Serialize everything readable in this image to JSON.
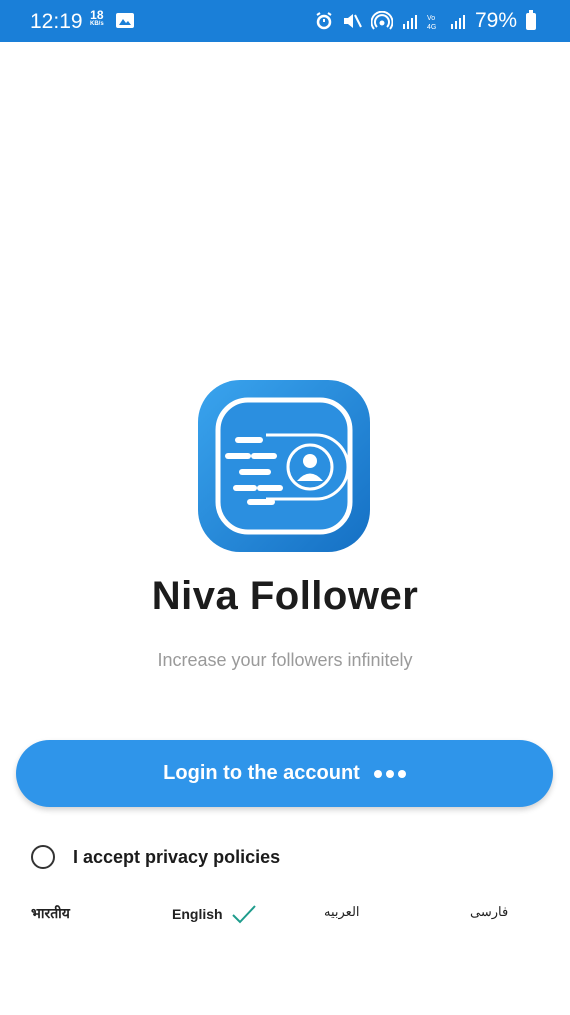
{
  "status_bar": {
    "time": "12:19",
    "net_speed_value": "18",
    "net_speed_unit": "KB/s",
    "battery_percent": "79%",
    "icons": [
      "image-icon",
      "alarm-icon",
      "mute-icon",
      "hotspot-icon",
      "signal-icon",
      "lte-icon",
      "signal-icon",
      "battery-icon"
    ]
  },
  "app": {
    "name": "Niva Follower",
    "tagline": "Increase your followers infinitely",
    "logo_icon": "fast-user-icon"
  },
  "login_button": {
    "label": "Login to the account",
    "icon": "more-dots-icon"
  },
  "privacy": {
    "label": "I accept privacy policies",
    "checked": false
  },
  "languages": {
    "items": [
      {
        "label": "भारतीय",
        "selected": false
      },
      {
        "label": "English",
        "selected": true
      },
      {
        "label": "العربیه",
        "selected": false
      },
      {
        "label": "فارسی",
        "selected": false
      }
    ],
    "selected_icon": "checkmark-icon"
  },
  "colors": {
    "status_bar": "#1a7fd8",
    "button": "#2f95ea",
    "check": "#1e9c8c"
  }
}
